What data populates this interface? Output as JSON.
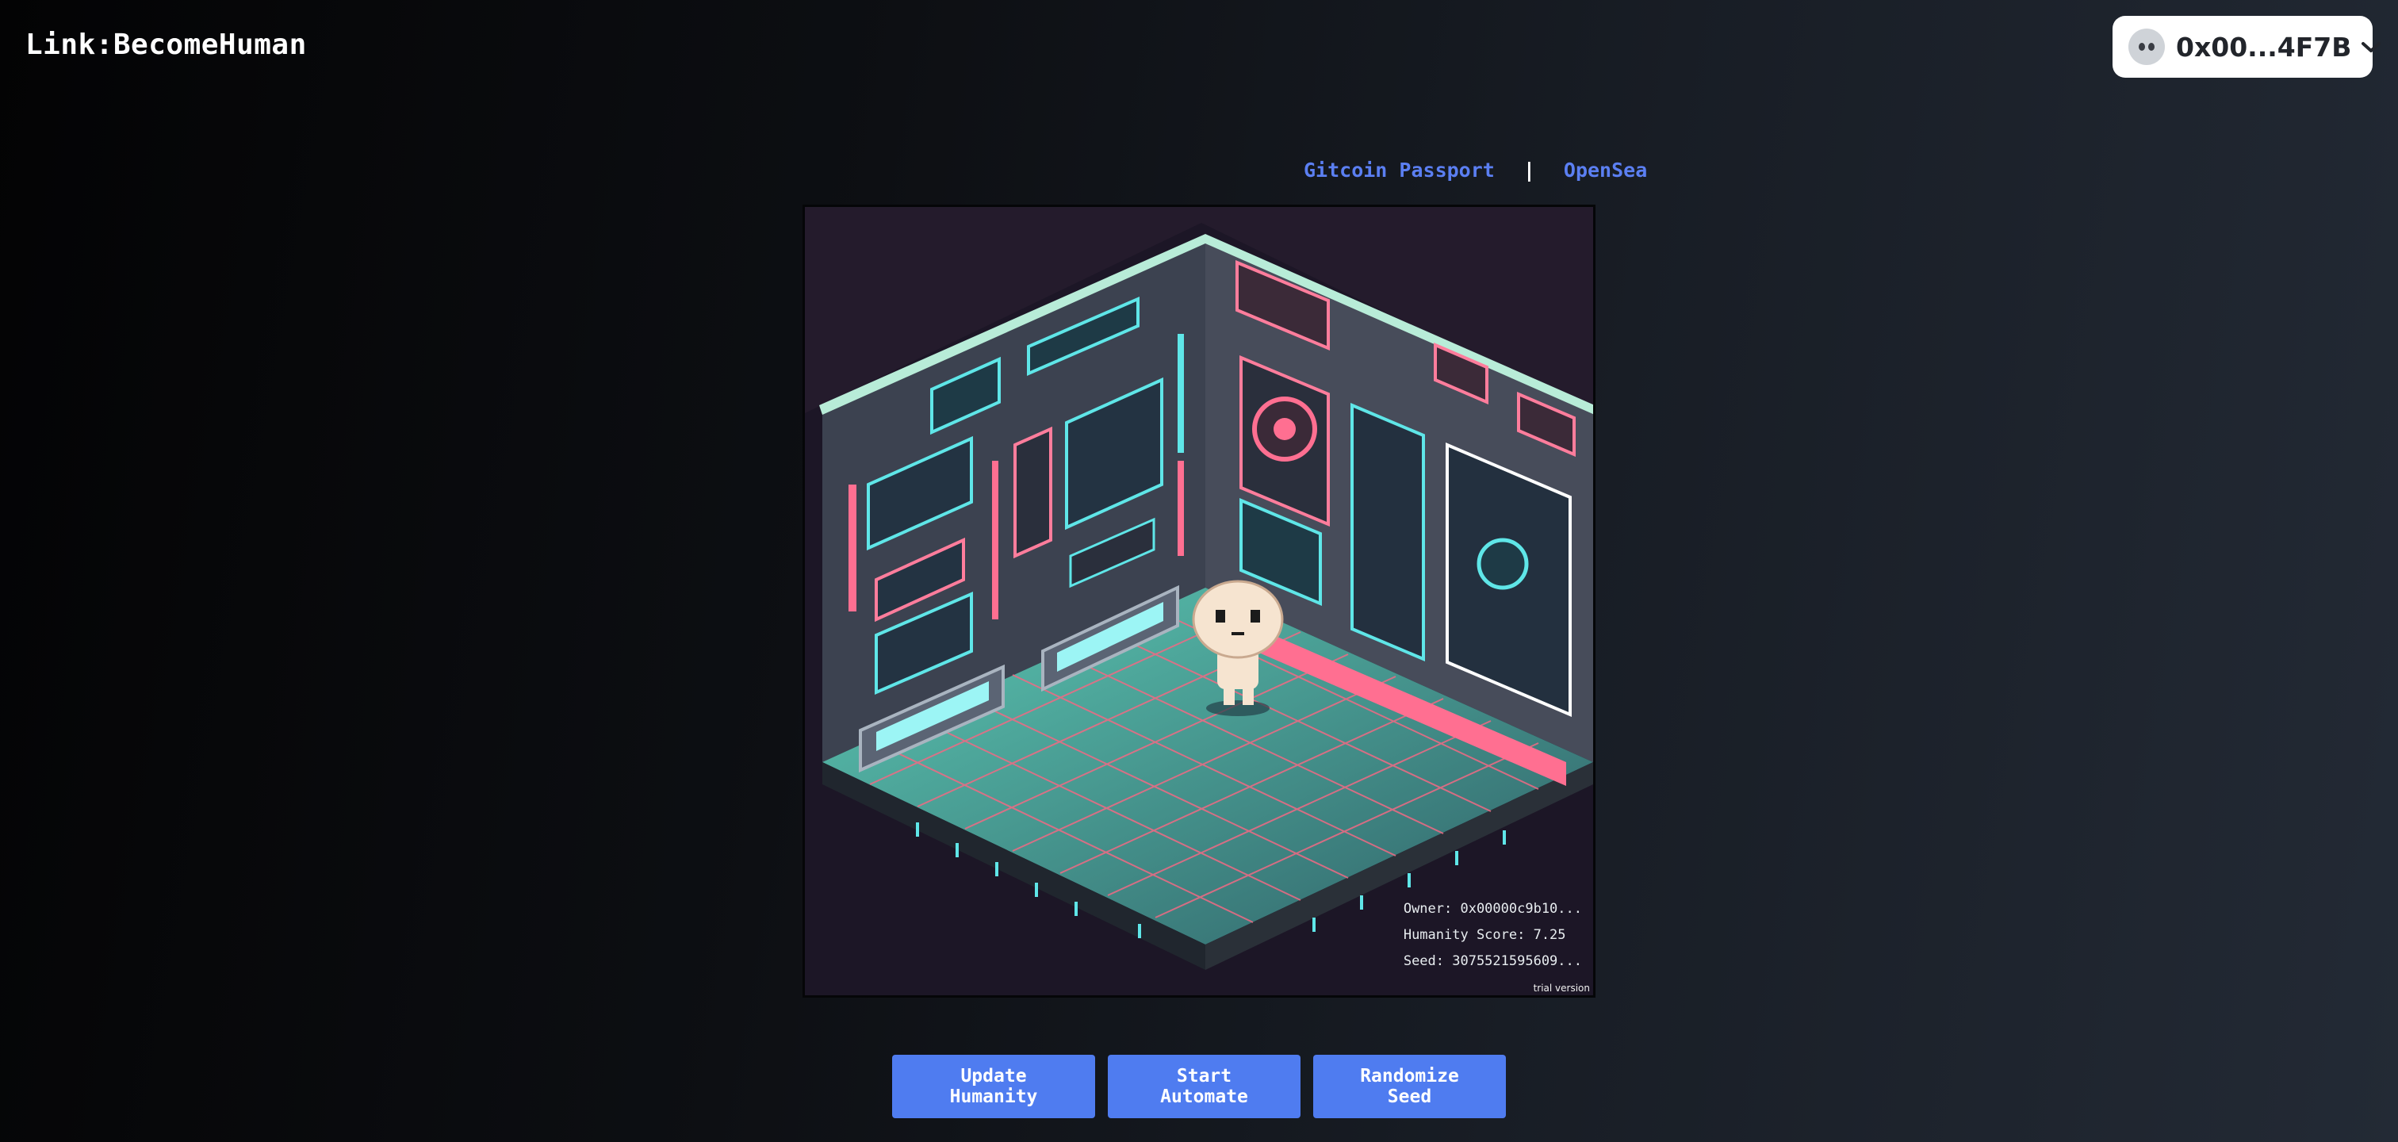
{
  "header": {
    "app_title": "Link:BecomeHuman",
    "wallet": {
      "address": "0x00...4F7B",
      "avatar_icon": "alien-icon",
      "menu_icon": "chevron-down-icon"
    }
  },
  "links": {
    "gitcoin": "Gitcoin Passport",
    "separator": "|",
    "opensea": "OpenSea"
  },
  "artwork": {
    "owner": "Owner: 0x00000c9b10...",
    "humanity_score": "Humanity Score: 7.25",
    "seed": "Seed: 3075521595609...",
    "watermark": "trial version"
  },
  "actions": {
    "update_label": "Update Humanity",
    "start_label": "Start Automate",
    "randomize_label": "Randomize Seed"
  },
  "colors": {
    "accent": "#4f7cf0",
    "link": "#5b7ff2",
    "neon_pink": "#ff6f91",
    "neon_cyan": "#5fe6e8"
  }
}
